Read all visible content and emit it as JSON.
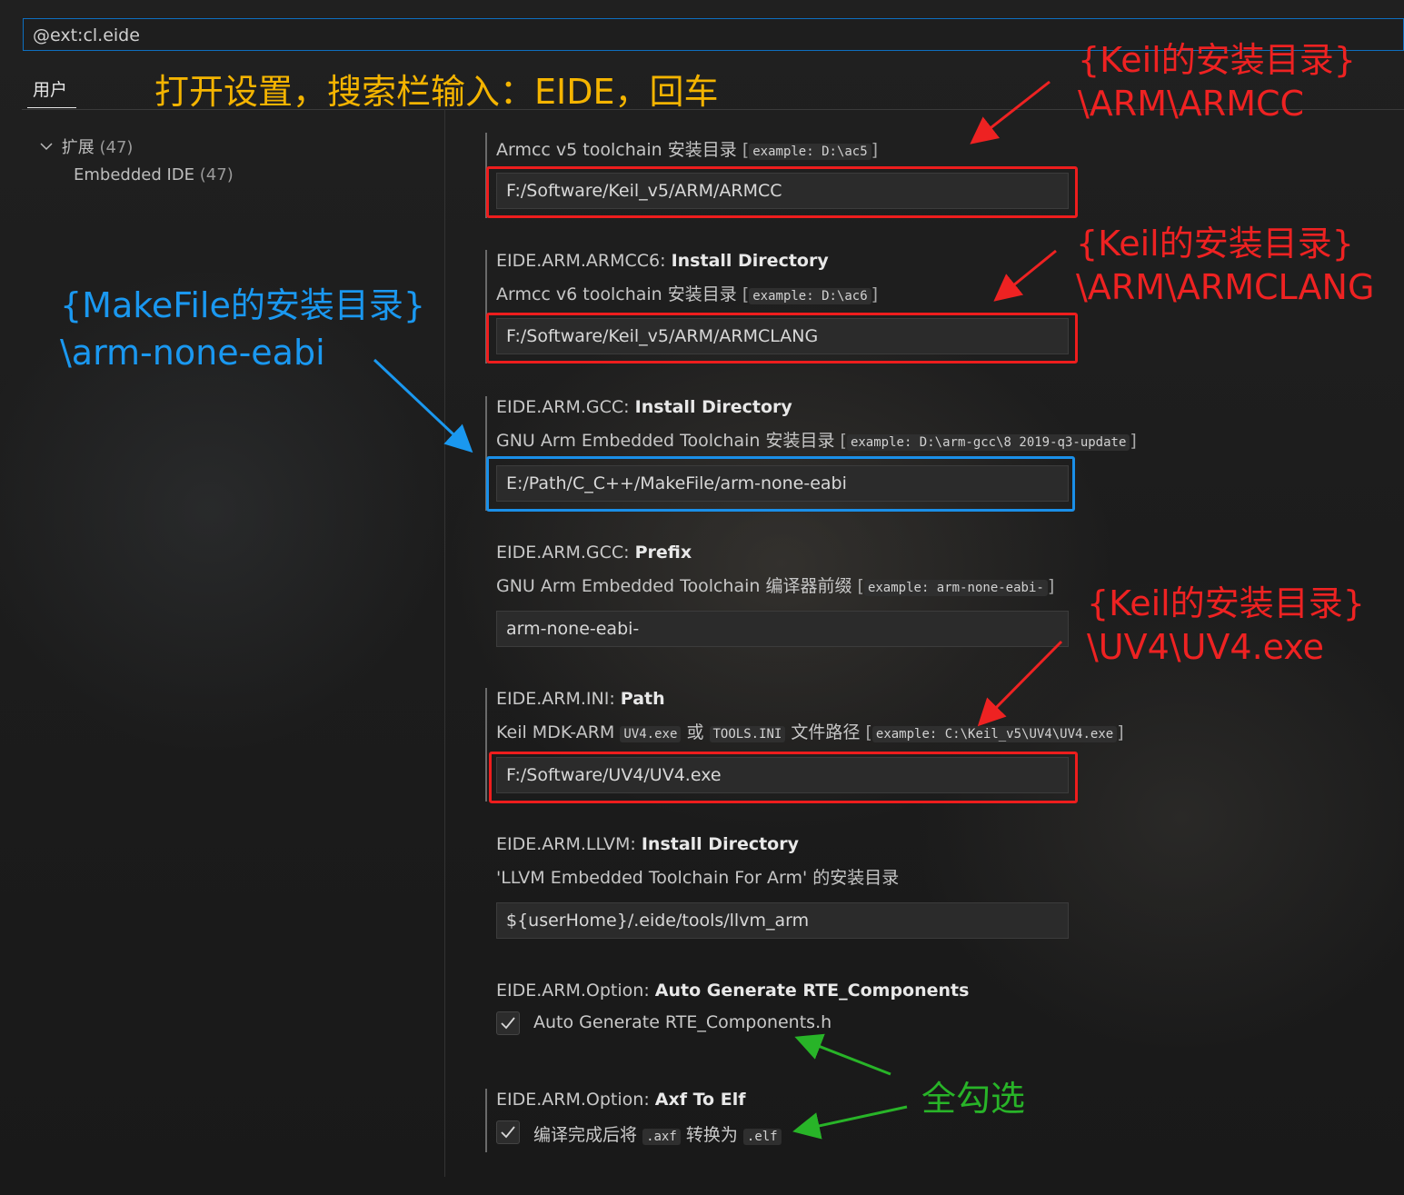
{
  "search": {
    "value": "@ext:cl.eide"
  },
  "tabs": {
    "user": "用户"
  },
  "tree": {
    "ext_label": "扩展",
    "ext_count": "(47)",
    "child_label": "Embedded IDE",
    "child_count": "(47)"
  },
  "settings": {
    "armcc5": {
      "desc": "Armcc v5 toolchain 安装目录",
      "example": "example: D:\\ac5",
      "value": "F:/Software/Keil_v5/ARM/ARMCC"
    },
    "armcc6": {
      "cat": "EIDE.ARM.ARMCC6: ",
      "name": "Install Directory",
      "desc": "Armcc v6 toolchain 安装目录",
      "example": "example: D:\\ac6",
      "value": "F:/Software/Keil_v5/ARM/ARMCLANG"
    },
    "gcc": {
      "cat": "EIDE.ARM.GCC: ",
      "name": "Install Directory",
      "desc": "GNU Arm Embedded Toolchain 安装目录",
      "example": "example: D:\\arm-gcc\\8 2019-q3-update",
      "value": "E:/Path/C_C++/MakeFile/arm-none-eabi"
    },
    "gcc_prefix": {
      "cat": "EIDE.ARM.GCC: ",
      "name": "Prefix",
      "desc": "GNU Arm Embedded Toolchain 编译器前缀",
      "example": "example: arm-none-eabi-",
      "value": "arm-none-eabi-"
    },
    "ini": {
      "cat": "EIDE.ARM.INI: ",
      "name": "Path",
      "desc_a": "Keil MDK-ARM",
      "code_a": "UV4.exe",
      "desc_b": "或",
      "code_b": "TOOLS.INI",
      "desc_c": "文件路径",
      "example": "example: C:\\Keil_v5\\UV4\\UV4.exe",
      "value": "F:/Software/UV4/UV4.exe"
    },
    "llvm": {
      "cat": "EIDE.ARM.LLVM: ",
      "name": "Install Directory",
      "desc": "'LLVM Embedded Toolchain For Arm' 的安装目录",
      "value": "${userHome}/.eide/tools/llvm_arm"
    },
    "rte": {
      "cat": "EIDE.ARM.Option: ",
      "name": "Auto Generate RTE_Components",
      "label": "Auto Generate RTE_Components.h",
      "checked": true
    },
    "axf": {
      "cat": "EIDE.ARM.Option: ",
      "name": "Axf To Elf",
      "label_a": "编译完成后将",
      "code_a": ".axf",
      "label_b": "转换为",
      "code_b": ".elf",
      "checked": true
    }
  },
  "annotations": {
    "top": "打开设置，搜索栏输入：EIDE，回车",
    "armcc_1": "{Keil的安装目录}",
    "armcc_2": "\\ARM\\ARMCC",
    "armclang_1": "{Keil的安装目录}",
    "armclang_2": "\\ARM\\ARMCLANG",
    "makefile_1": "{MakeFile的安装目录}",
    "makefile_2": "\\arm-none-eabi",
    "uv4_1": "{Keil的安装目录}",
    "uv4_2": "\\UV4\\UV4.exe",
    "check_all": "全勾选"
  },
  "colors": {
    "annotation_red": "#ee2222",
    "annotation_blue": "#1a98f0",
    "annotation_yellow": "#f4b400",
    "annotation_green": "#28b428",
    "focus_border": "#0e6fc0"
  }
}
